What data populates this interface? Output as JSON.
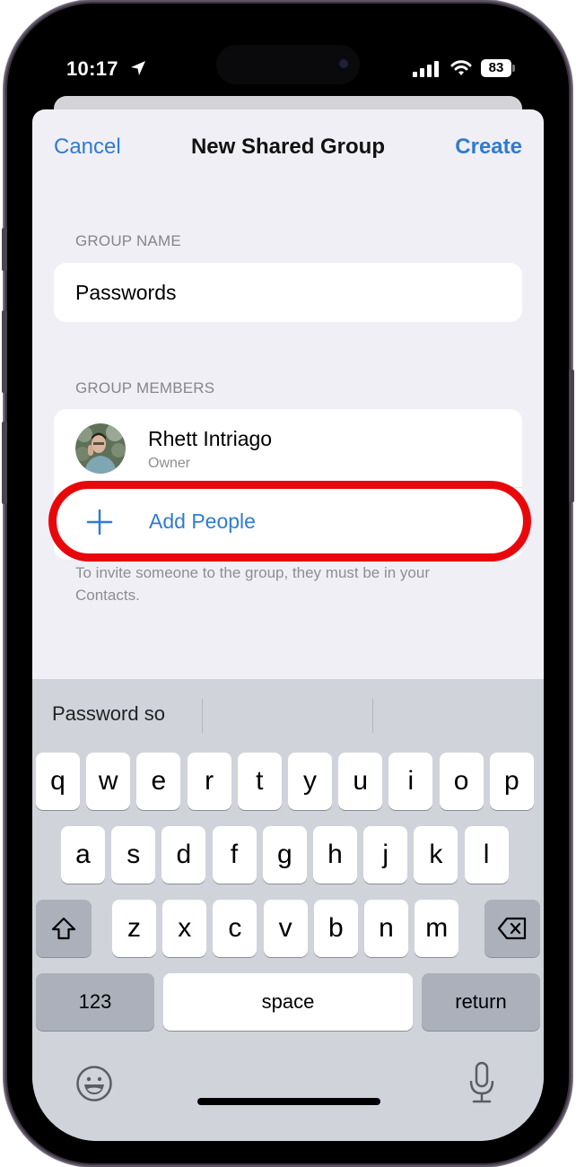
{
  "status_bar": {
    "time": "10:17",
    "battery": "83",
    "icons": [
      "location-arrow-icon",
      "signal-icon",
      "wifi-icon",
      "battery-icon"
    ]
  },
  "nav": {
    "cancel_label": "Cancel",
    "title": "New Shared Group",
    "create_label": "Create"
  },
  "group_name": {
    "header": "GROUP NAME",
    "value": "Passwords"
  },
  "group_members": {
    "header": "GROUP MEMBERS",
    "members": [
      {
        "name": "Rhett Intriago",
        "role": "Owner"
      }
    ],
    "add_label": "Add People",
    "footer": "To invite someone to the group, they must be in your Contacts."
  },
  "keyboard": {
    "suggestions": [
      "Password so",
      "",
      ""
    ],
    "row1": [
      "q",
      "w",
      "e",
      "r",
      "t",
      "y",
      "u",
      "i",
      "o",
      "p"
    ],
    "row2": [
      "a",
      "s",
      "d",
      "f",
      "g",
      "h",
      "j",
      "k",
      "l"
    ],
    "row3": [
      "z",
      "x",
      "c",
      "v",
      "b",
      "n",
      "m"
    ],
    "numbers_label": "123",
    "space_label": "space",
    "return_label": "return"
  },
  "colors": {
    "accent": "#2f7bd1",
    "highlight": "#e8080c",
    "background": "#f0eff5",
    "keyboard_bg": "#d0d3da"
  }
}
